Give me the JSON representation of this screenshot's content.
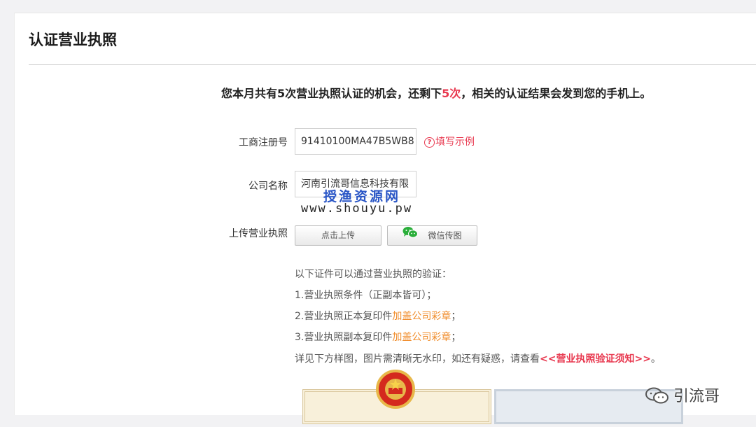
{
  "header": {
    "title": "认证营业执照"
  },
  "notice": {
    "prefix": "您本月共有5次营业执照认证的机会，还剩下",
    "remaining": "5次",
    "suffix": "，相关的认证结果会发到您的手机上。"
  },
  "form": {
    "reg_no_label": "工商注册号",
    "reg_no_value": "91410100MA47B5WB8",
    "example_link": "填写示例",
    "company_label": "公司名称",
    "company_value": "河南引流哥信息科技有限",
    "upload_label": "上传营业执照",
    "upload_button": "点击上传",
    "wechat_button": "微信传图"
  },
  "watermark": {
    "cn": "授渔资源网",
    "url": "www.shouyu.pw"
  },
  "info": {
    "line1": "以下证件可以通过营业执照的验证：",
    "line2": "1.营业执照条件（正副本皆可）；",
    "line3_prefix": "2.营业执照正本复印件",
    "line3_highlight": "加盖公司彩章",
    "line3_suffix": "；",
    "line4_prefix": "3.营业执照副本复印件",
    "line4_highlight": "加盖公司彩章",
    "line4_suffix": "；",
    "line5_prefix": "详见下方样图，图片需清晰无水印，如还有疑惑，请查看",
    "line5_link": "<<营业执照验证须知>>",
    "line5_suffix": "。"
  },
  "brand": {
    "name": "引流哥"
  },
  "colors": {
    "accent_red": "#e8384f",
    "highlight_orange": "#f08c2a",
    "wechat_green": "#2aae3a"
  },
  "icons": {
    "example": "question-circle-icon",
    "wechat": "wechat-icon",
    "emblem": "national-emblem-icon",
    "brand": "wechat-official-account-icon"
  }
}
